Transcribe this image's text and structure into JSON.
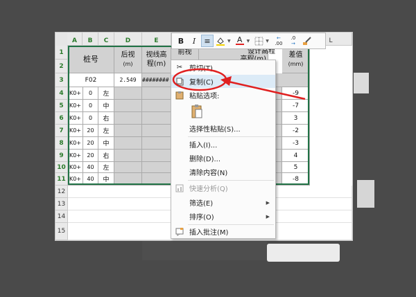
{
  "columns": {
    "A": "A",
    "B": "B",
    "C": "C",
    "D": "D",
    "E": "E",
    "L": "L"
  },
  "rows": [
    "1",
    "2",
    "3",
    "4",
    "5",
    "6",
    "7",
    "8",
    "9",
    "10",
    "11",
    "12",
    "13",
    "14",
    "15"
  ],
  "headers": {
    "stake": "桩号",
    "back_sight": "后视",
    "back_sight_unit": "(m)",
    "sight_height": "视线高",
    "sight_height_unit": "程(m)",
    "front_sight": "前视",
    "elevation": "高程(m)",
    "design_elev": "设计高程",
    "diff": "差值",
    "diff_unit": "(mm)"
  },
  "row3": {
    "station": "F02",
    "back_sight": "2.549",
    "sight_height": "########"
  },
  "data_rows": [
    {
      "k": "K0+",
      "n": "0",
      "dir": "左",
      "diff": "-9"
    },
    {
      "k": "K0+",
      "n": "0",
      "dir": "中",
      "diff": "-7"
    },
    {
      "k": "K0+",
      "n": "0",
      "dir": "右",
      "diff": "3"
    },
    {
      "k": "K0+",
      "n": "20",
      "dir": "左",
      "diff": "-2"
    },
    {
      "k": "K0+",
      "n": "20",
      "dir": "中",
      "diff": "-3"
    },
    {
      "k": "K0+",
      "n": "20",
      "dir": "右",
      "diff": "4"
    },
    {
      "k": "K0+",
      "n": "40",
      "dir": "左",
      "diff": "5"
    },
    {
      "k": "K0+",
      "n": "40",
      "dir": "中",
      "diff": "-8"
    }
  ],
  "minibar": {
    "bold": "B",
    "italic": "I",
    "align": "≡",
    "font_color": "A",
    "increase_decimal": ".00",
    "decrease_decimal": ".0"
  },
  "context_menu": {
    "cut": "剪切(T)",
    "copy": "复制(C)",
    "paste_options": "粘贴选项:",
    "paste_special": "选择性粘贴(S)...",
    "insert": "插入(I)...",
    "delete": "删除(D)...",
    "clear": "清除内容(N)",
    "quick_analysis": "快速分析(Q)",
    "filter": "筛选(E)",
    "sort": "排序(O)",
    "insert_comment": "插入批注(M)"
  },
  "colors": {
    "selection": "#217346",
    "annotation": "#e02020",
    "highlight": "#dcebf7"
  }
}
